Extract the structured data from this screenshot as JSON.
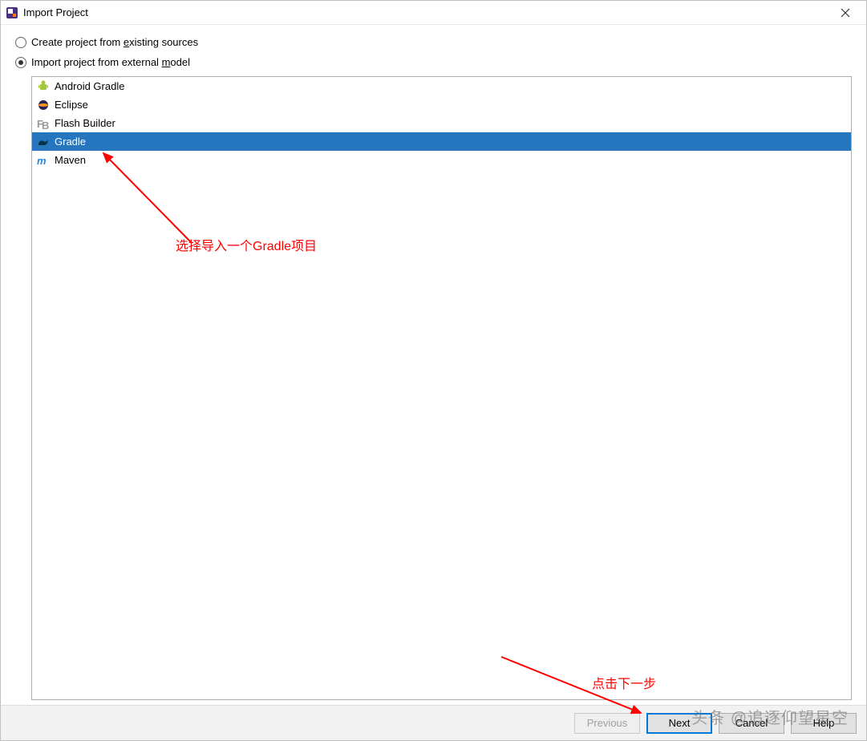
{
  "window": {
    "title": "Import Project"
  },
  "options": {
    "create_existing": "Create project from existing sources",
    "create_existing_ul": "e",
    "import_external": "Import project from external model",
    "import_external_ul": "m"
  },
  "models": [
    {
      "icon": "android",
      "label": "Android Gradle"
    },
    {
      "icon": "eclipse",
      "label": "Eclipse"
    },
    {
      "icon": "flashbuilder",
      "label": "Flash Builder"
    },
    {
      "icon": "gradle",
      "label": "Gradle",
      "selected": true
    },
    {
      "icon": "maven",
      "label": "Maven"
    }
  ],
  "footer": {
    "previous": "Previous",
    "next": "Next",
    "cancel": "Cancel",
    "help": "Help"
  },
  "annotations": {
    "select_gradle": "选择导入一个Gradle项目",
    "click_next": "点击下一步"
  },
  "watermark": "头条 @追逐仰望星空"
}
